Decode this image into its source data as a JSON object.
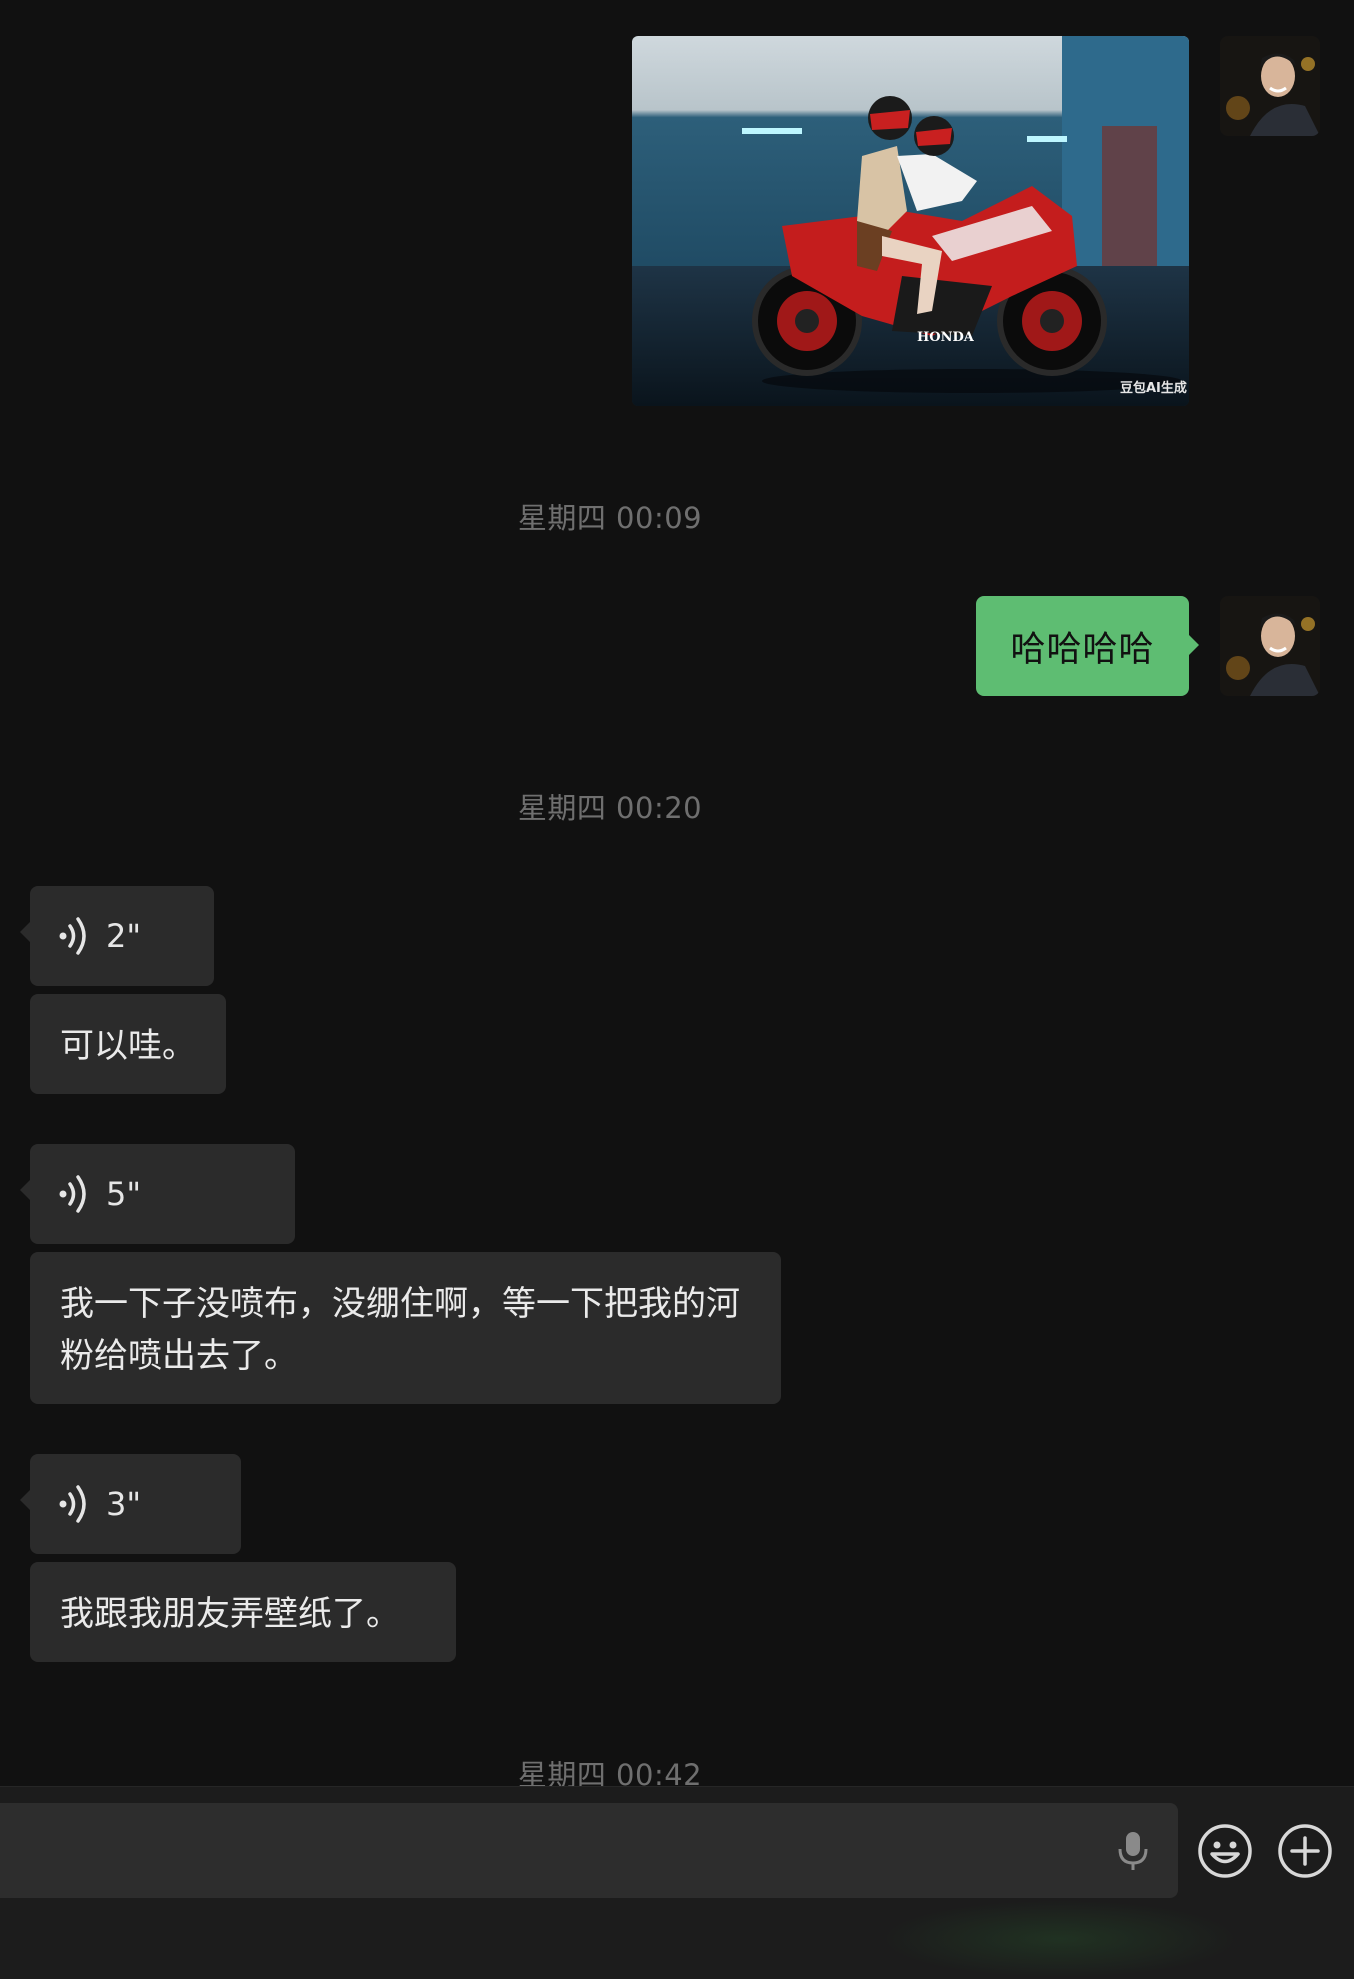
{
  "messages": {
    "image_watermark": "豆包AI生成",
    "image_brand": "HONDA",
    "timestamp_1": "星期四 00:09",
    "sent_text": "哈哈哈哈",
    "timestamp_2": "星期四 00:20",
    "voice_1_duration": "2\"",
    "text_1": "可以哇。",
    "voice_2_duration": "5\"",
    "text_2": "我一下子没喷布，没绷住啊，等一下把我的河粉给喷出去了。",
    "voice_3_duration": "3\"",
    "text_3": "我跟我朋友弄壁纸了。",
    "timestamp_3": "星期四 00:42"
  },
  "colors": {
    "background": "#111111",
    "sent_bubble": "#5ebd72",
    "received_bubble": "#2b2b2b",
    "timestamp": "#6f6f6f",
    "input_bar": "#1c1c1c"
  },
  "icons": {
    "voice": "voice-wave-icon",
    "mic": "microphone-icon",
    "emoji": "emoji-icon",
    "plus": "plus-circle-icon"
  }
}
